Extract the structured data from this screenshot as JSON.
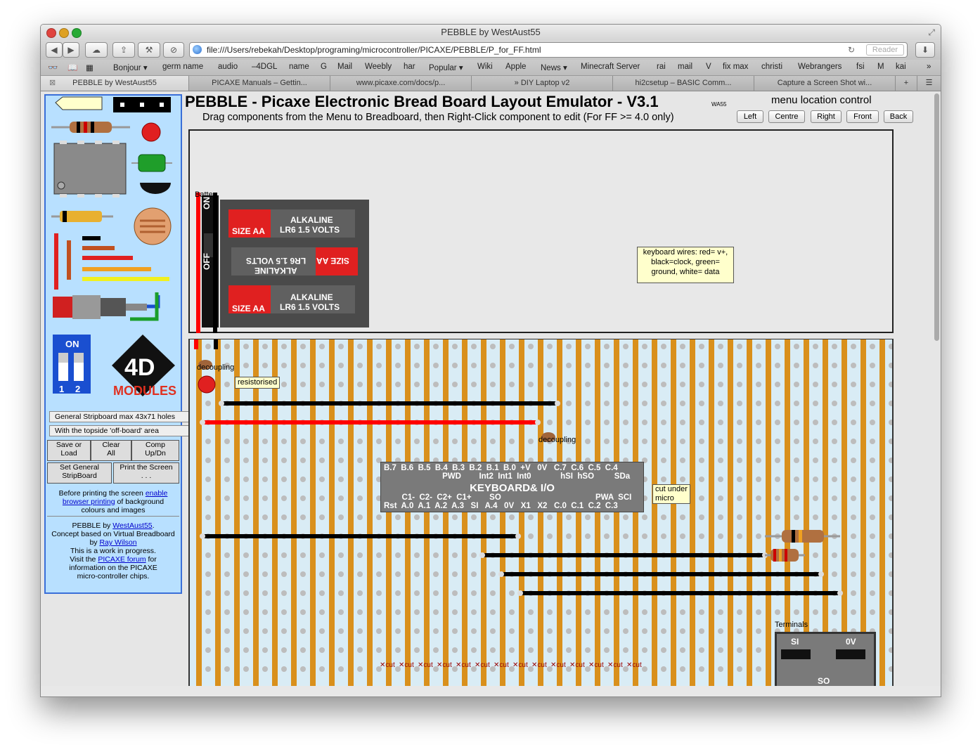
{
  "window": {
    "title": "PEBBLE by WestAust55"
  },
  "toolbar": {
    "url": "file:///Users/rebekah/Desktop/programing/microcontroller/PICAXE/PEBBLE/P_for_FF.html",
    "reader_label": "Reader",
    "reload_icon": "↻"
  },
  "bookmarks": [
    "Bonjour ▾",
    "germ name",
    "audio",
    "–4DGL",
    "name",
    "G",
    "Mail",
    "Weebly",
    "har",
    "Popular ▾",
    "Wiki",
    "Apple",
    "News ▾",
    "Minecraft Server",
    "rai",
    "mail",
    "V",
    "fix max",
    "christi",
    "Webrangers",
    "fsi",
    "M",
    "kai"
  ],
  "tabs": [
    "PEBBLE by WestAust55",
    "PICAXE Manuals – Gettin...",
    "www.picaxe.com/docs/p...",
    "» DIY Laptop v2",
    "hi2csetup – BASIC Comm...",
    "Capture a Screen Shot wi..."
  ],
  "page": {
    "heading": "PEBBLE - Picaxe Electronic Bread Board Layout Emulator - V3.1",
    "heading_tag": "WA55",
    "subheading": "Drag components from the Menu to Breadboard, then Right-Click component to edit (For FF >= 4.0 only)",
    "menu_location": {
      "title": "menu location control",
      "buttons": [
        "Left",
        "Centre",
        "Right",
        "Front",
        "Back"
      ]
    }
  },
  "menu": {
    "dip_on": "ON",
    "dip_labels": [
      "1",
      "2"
    ],
    "modules_label": "MODULES",
    "field1": "General Stripboard max 43x71 holes",
    "field2": "With the topside 'off-board' area",
    "buttons": [
      {
        "line1": "Save or",
        "line2": "Load"
      },
      {
        "line1": "Clear",
        "line2": "All"
      },
      {
        "line1": "Comp",
        "line2": "Up/Dn"
      },
      {
        "line1": "Set General",
        "line2": "StripBoard"
      },
      {
        "line1": "Print the Screen",
        "line2": ". . ."
      }
    ],
    "print_note": {
      "a": "Before printing the screen ",
      "link1": "enable",
      "link2": "browser printing",
      "b": " of background",
      "c": "colours and images"
    },
    "credits": {
      "l1a": "PEBBLE by ",
      "l1link": "WestAust55",
      "l1b": ".",
      "l2": "Concept based on Virtual Breadboard",
      "l3a": "by ",
      "l3link": "Ray Wilson",
      "l4": "This is a work in progress.",
      "l5a": "Visit the ",
      "l5link": "PICAXE forum",
      "l5b": " for",
      "l6": "information on the PICAXE",
      "l7": "micro-controller chips."
    }
  },
  "offboard": {
    "battery_label": "Batte",
    "switch_on": "ON",
    "switch_off": "OFF",
    "cells": [
      {
        "brand": "ALKALINE",
        "spec": "LR6 1.5 VOLTS",
        "size": "SIZE AA"
      },
      {
        "brand": "ALKALINE",
        "spec": "LR6 1.5 VOLTS",
        "size": "SIZE AA"
      },
      {
        "brand": "ALKALINE",
        "spec": "LR6 1.5 VOLTS",
        "size": "SIZE AA"
      }
    ],
    "note": "keyboard wires: red= v+, black=clock, green= ground, white= data"
  },
  "board": {
    "label_decoupling": "decoupling",
    "label_resistorised": "resistorised",
    "label_decoupling2": "decoupling",
    "label_cut_under": "cut under",
    "label_micro": "micro",
    "chip": {
      "top_pins": "B.7  B.6  B.5  B.4  B.3  B.2  B.1  B.0  +V   0V   C.7  C.6  C.5  C.4",
      "top_pins2": "                          PWD        Int2  Int1  Int0             hSI  hSO         SDa",
      "name": "KEYBOARD& I/O",
      "bot_pins1": "        C1-  C2-  C2+  C1+        SO                                          PWA  SCI",
      "bot_pins2": "Rst  A.0  A.1  A.2  A.3   SI   A.4   0V   X1   X2   C.0  C.1  C.2  C.3"
    },
    "terminals": {
      "title": "Terminals",
      "si": "SI",
      "ov": "0V",
      "so": "SO"
    },
    "cut_label": "cut",
    "cut_count": 14
  },
  "colors": {
    "stripe": "#d9901c",
    "board_bg": "#d9ecf5",
    "menu_bg": "#b8e0ff",
    "menu_border": "#3a6fd8",
    "wire_red": "#ff0000",
    "wire_black": "#000000"
  }
}
